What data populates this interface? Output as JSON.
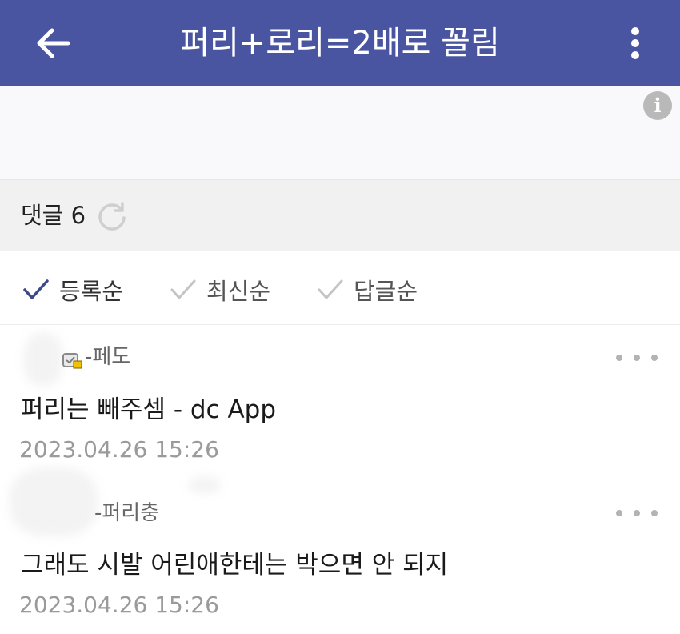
{
  "header": {
    "title": "퍼리+로리=2배로 꼴림",
    "back_icon": "arrow-left-icon",
    "menu_icon": "more-vertical-icon",
    "color": "#4a55a2"
  },
  "ad": {
    "info_icon": "info-icon",
    "info_glyph": "i"
  },
  "comments_section": {
    "label": "댓글 6",
    "refresh_icon": "refresh-icon"
  },
  "sort": {
    "options": [
      {
        "label": "등록순",
        "active": true
      },
      {
        "label": "최신순",
        "active": false
      },
      {
        "label": "답글순",
        "active": false
      }
    ],
    "active_color": "#3c4a86",
    "inactive_color": "#c4c4c4"
  },
  "comments": [
    {
      "nick": "-페도",
      "text": "퍼리는 빼주셈 - dc App",
      "date": "2023.04.26 15:26"
    },
    {
      "nick": "-퍼리충",
      "text": "그래도 시발 어린애한테는 박으면 안 되지",
      "date": "2023.04.26 15:26"
    }
  ]
}
